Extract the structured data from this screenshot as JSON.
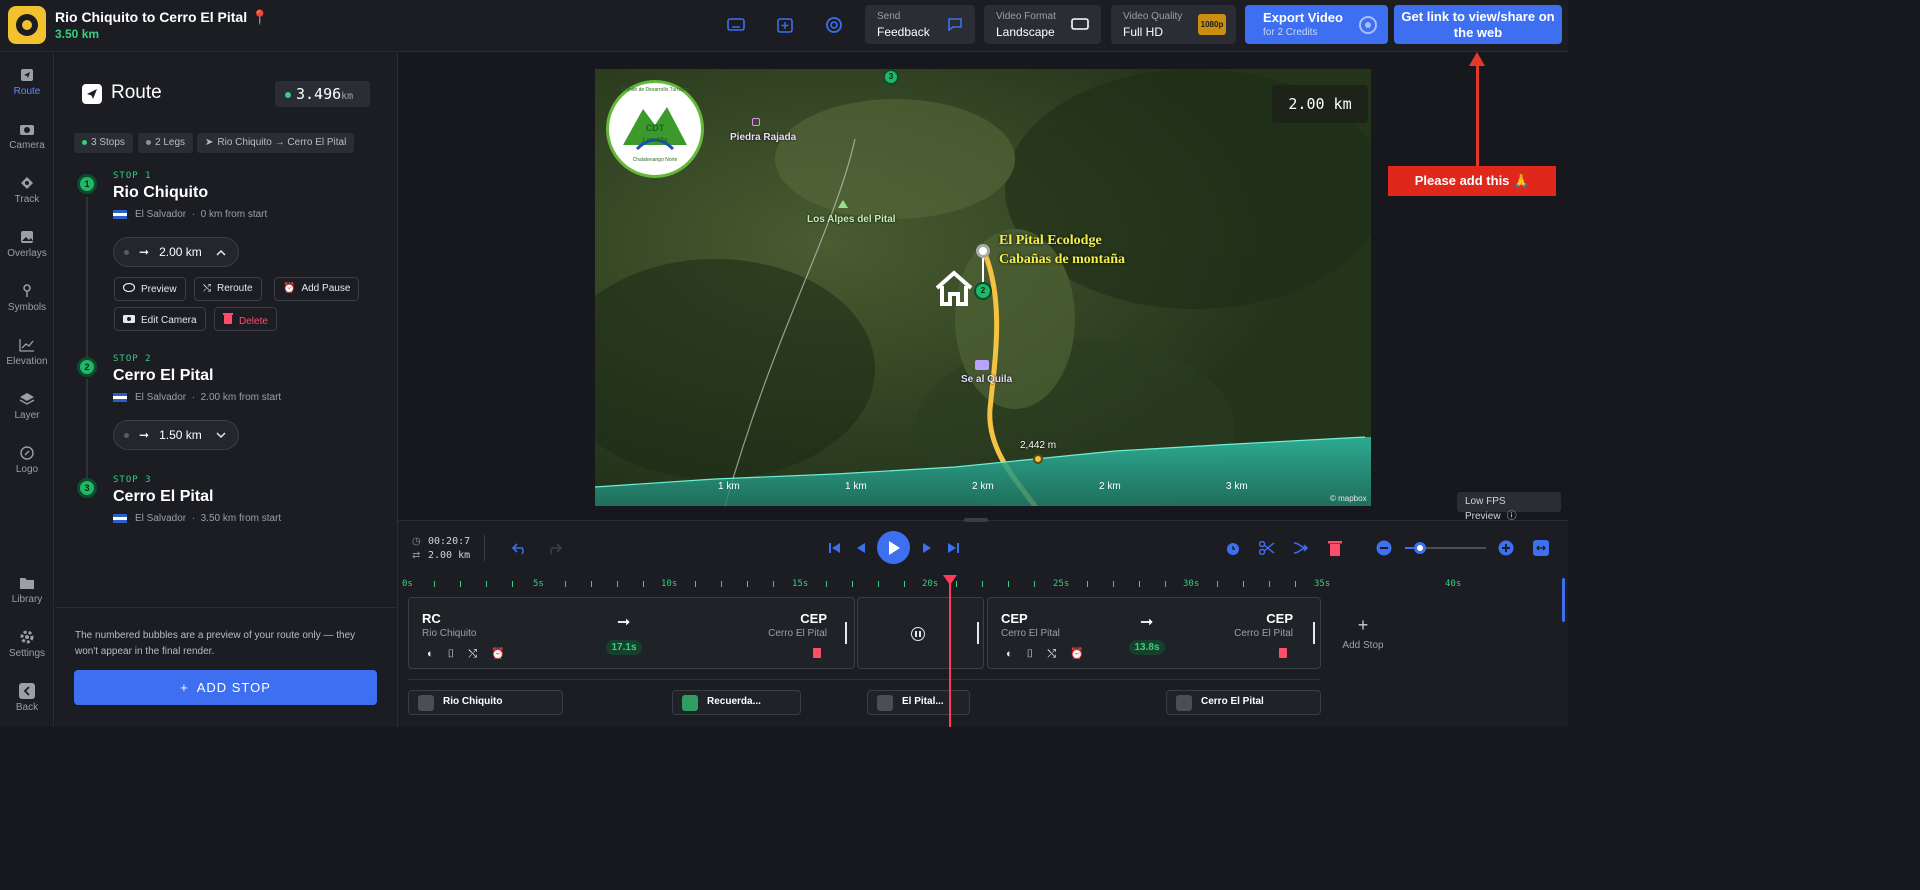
{
  "project": {
    "title": "Rio Chiquito to Cerro El Pital 📍",
    "distance": "3.50 km"
  },
  "toolbar": {
    "feedback": {
      "label": "Send",
      "value": "Feedback"
    },
    "video_format": {
      "label": "Video Format",
      "value": "Landscape"
    },
    "video_quality": {
      "label": "Video Quality",
      "value": "Full HD",
      "badge": "1080p"
    },
    "export": {
      "title": "Export Video",
      "subtitle": "for 2 Credits"
    },
    "share": {
      "label": "Get link to view/share on the web"
    }
  },
  "nav": {
    "items": [
      {
        "label": "Route",
        "icon": "route-icon"
      },
      {
        "label": "Camera",
        "icon": "camera-icon"
      },
      {
        "label": "Track",
        "icon": "track-icon"
      },
      {
        "label": "Overlays",
        "icon": "overlays-icon"
      },
      {
        "label": "Symbols",
        "icon": "symbols-icon"
      },
      {
        "label": "Elevation",
        "icon": "elevation-icon"
      },
      {
        "label": "Layer",
        "icon": "layer-icon"
      },
      {
        "label": "Logo",
        "icon": "logo-icon"
      }
    ],
    "bottom": [
      {
        "label": "Library",
        "icon": "library-icon"
      },
      {
        "label": "Settings",
        "icon": "settings-icon"
      },
      {
        "label": "Back",
        "icon": "back-icon"
      }
    ]
  },
  "route": {
    "title": "Route",
    "total": "3.496",
    "unit": "km",
    "chips": [
      "3 Stops",
      "2 Legs",
      "Rio Chiquito → Cerro El Pital"
    ],
    "stops": [
      {
        "kicker": "STOP 1",
        "name": "Rio Chiquito",
        "country": "El Salvador",
        "from_start": "0 km from start",
        "num": "1"
      },
      {
        "kicker": "STOP 2",
        "name": "Cerro El Pital",
        "country": "El Salvador",
        "from_start": "2.00 km from start",
        "num": "2"
      },
      {
        "kicker": "STOP 3",
        "name": "Cerro El Pital",
        "country": "El Salvador",
        "from_start": "3.50 km from start",
        "num": "3"
      }
    ],
    "legs": [
      {
        "distance": "2.00 km",
        "chevron": "chevron-up-icon"
      },
      {
        "distance": "1.50 km",
        "chevron": "chevron-down-icon"
      }
    ],
    "sep": "·",
    "actions": {
      "preview": "Preview",
      "reroute": "Reroute",
      "add_pause": "Add Pause",
      "edit_camera": "Edit Camera",
      "delete": "Delete"
    },
    "note": "The numbered bubbles are a preview of your route only — they won't appear in the final render.",
    "add_stop": "ADD STOP"
  },
  "map": {
    "scale_badge": "2.00 km",
    "labels": {
      "piedra": "Piedra Rajada",
      "alpes": "Los Alpes del Pital",
      "ecolodge_1": "El Pital Ecolodge",
      "ecolodge_2": "Cabañas de montaña",
      "quila": "Se al Quila",
      "elev": "2,442 m",
      "attribution": "© mapbox"
    },
    "logo_text": {
      "top": "Comité de Desarrollo Turístico",
      "main": "CDT",
      "sub": "Las Alta",
      "bottom": "Chalatenango Norte"
    },
    "km_ticks": [
      "1 km",
      "1 km",
      "2 km",
      "2 km",
      "3 km"
    ],
    "bubbles": [
      "2",
      "3"
    ],
    "low_fps": "Low FPS Preview"
  },
  "annotation": {
    "text": "Please add this 🙏"
  },
  "timeline": {
    "time": "00:20:7",
    "distance": "2.00 km",
    "ruler": [
      "0s",
      "5s",
      "10s",
      "15s",
      "20s",
      "25s",
      "30s",
      "35s",
      "40s"
    ],
    "clips": [
      {
        "from_code": "RC",
        "from_name": "Rio Chiquito",
        "to_code": "CEP",
        "to_name": "Cerro El Pital",
        "duration": "17.1s"
      },
      {
        "from_code": "CEP",
        "from_name": "Cerro El Pital",
        "to_code": "CEP",
        "to_name": "Cerro El Pital",
        "duration": "13.8s"
      }
    ],
    "add_stop": "Add Stop",
    "tracks": [
      "Rio Chiquito",
      "Recuerda...",
      "El Pital...",
      "Cerro El Pital"
    ]
  },
  "colors": {
    "accent": "#3d6ff0",
    "green": "#35d07f",
    "danger": "#ff4d6a",
    "route": "#f5c242"
  }
}
